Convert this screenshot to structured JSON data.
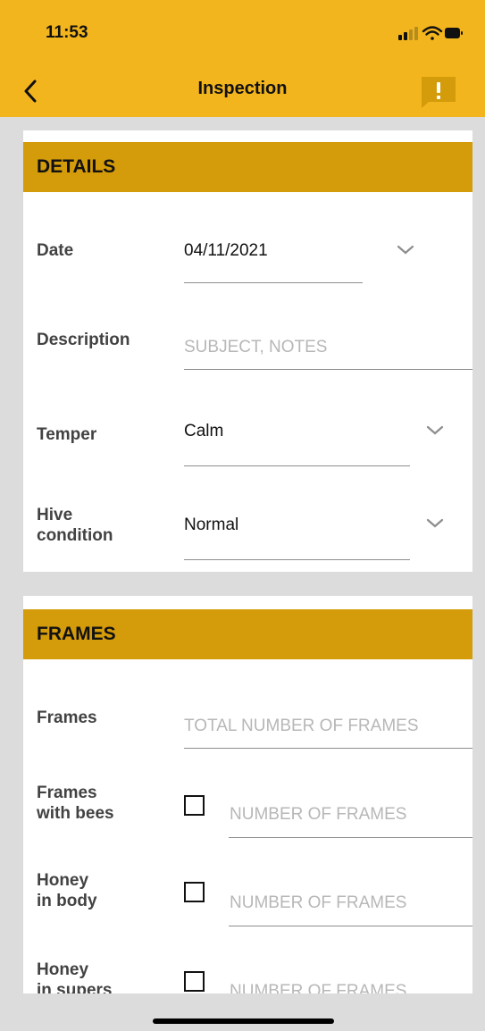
{
  "status_bar": {
    "time": "11:53",
    "icons": [
      "signal-icon",
      "wifi-icon",
      "battery-icon"
    ]
  },
  "nav": {
    "title": "Inspection",
    "back_icon": "chevron-left-icon",
    "report_icon": "report-exclamation-icon"
  },
  "details": {
    "header": "DETAILS",
    "date": {
      "label": "Date",
      "value": "04/11/2021"
    },
    "description": {
      "label": "Description",
      "placeholder": "SUBJECT, NOTES"
    },
    "temper": {
      "label": "Temper",
      "value": "Calm"
    },
    "hive_condition": {
      "label_line1": "Hive",
      "label_line2": "condition",
      "value": "Normal"
    }
  },
  "frames": {
    "header": "FRAMES",
    "frames": {
      "label": "Frames",
      "placeholder": "TOTAL NUMBER OF FRAMES"
    },
    "frames_with_bees": {
      "label_line1": "Frames",
      "label_line2": "with bees",
      "placeholder": "NUMBER OF FRAMES"
    },
    "honey_in_body": {
      "label_line1": "Honey",
      "label_line2": "in body",
      "placeholder": "NUMBER OF FRAMES"
    },
    "honey_in_supers": {
      "label_line1": "Honey",
      "label_line2": "in supers",
      "placeholder": "NUMBER OF FRAMES"
    }
  },
  "colors": {
    "accent": "#f3b51d",
    "section_header": "#d49b0a"
  }
}
